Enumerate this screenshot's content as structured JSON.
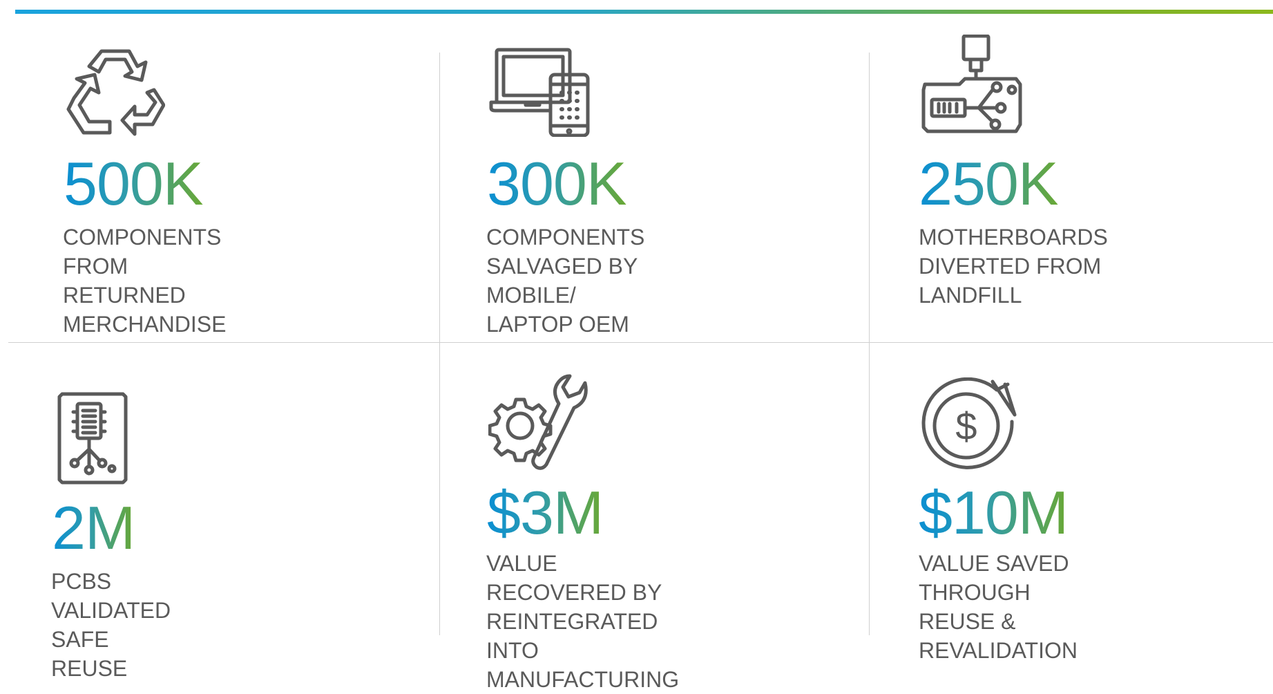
{
  "colors": {
    "accent_start": "#0a8fd3",
    "accent_end": "#6aa834",
    "text": "#5a5a5a",
    "divider": "#cfcfcf"
  },
  "stats": [
    {
      "icon": "recycle-icon",
      "value": "500K",
      "label": "COMPONENTS\nFROM RETURNED\nMERCHANDISE"
    },
    {
      "icon": "laptop-phone-icon",
      "value": "300K",
      "label": "COMPONENTS\nSALVAGED BY MOBILE/\nLAPTOP OEM"
    },
    {
      "icon": "motherboard-icon",
      "value": "250K",
      "label": "MOTHERBOARDS\nDIVERTED FROM\nLANDFILL"
    },
    {
      "icon": "pcb-chip-icon",
      "value": "2M",
      "label": "PCBS VALIDATED\nSAFE REUSE"
    },
    {
      "icon": "gear-wrench-icon",
      "value": "$3M",
      "label": "VALUE RECOVERED BY\nREINTEGRATED INTO\nMANUFACTURING"
    },
    {
      "icon": "dollar-cycle-icon",
      "value": "$10M",
      "label": "VALUE SAVED THROUGH\nREUSE & REVALIDATION"
    }
  ]
}
